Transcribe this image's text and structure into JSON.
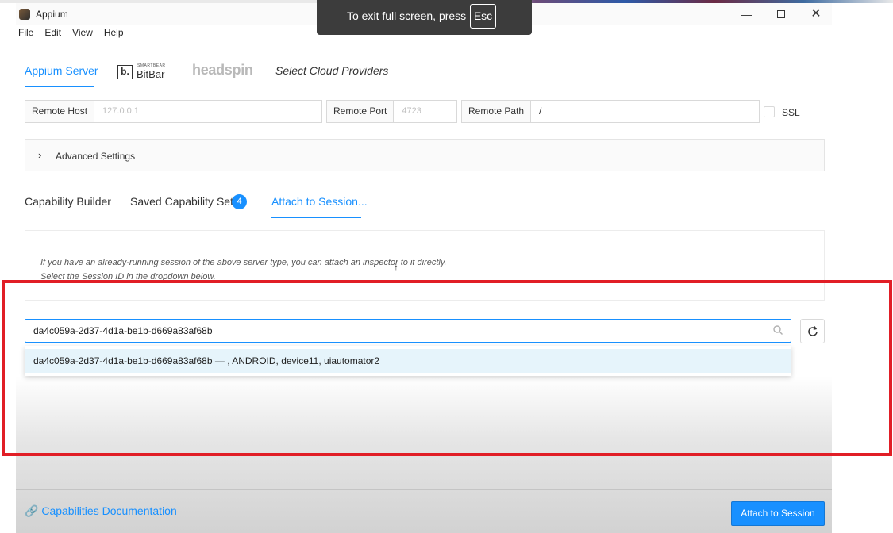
{
  "window": {
    "title": "Appium"
  },
  "menu": [
    "File",
    "Edit",
    "View",
    "Help"
  ],
  "fullscreen_toast": {
    "text": "To exit full screen, press",
    "key": "Esc"
  },
  "providers": {
    "appium_server": "Appium Server",
    "bitbar_small": "SMARTBEAR",
    "bitbar_mark": "b.",
    "bitbar_name": "BitBar",
    "headspin": "headspin",
    "select_cloud": "Select Cloud Providers"
  },
  "server": {
    "remote_host_label": "Remote Host",
    "remote_host_placeholder": "127.0.0.1",
    "remote_port_label": "Remote Port",
    "remote_port_placeholder": "4723",
    "remote_path_label": "Remote Path",
    "remote_path_value": "/",
    "ssl_label": "SSL"
  },
  "advanced_settings": "Advanced Settings",
  "capability_tabs": {
    "builder": "Capability Builder",
    "saved": "Saved Capability Sets",
    "saved_count": "4",
    "attach": "Attach to Session..."
  },
  "attach": {
    "hint_line1": "If you have an already-running session of the above server type, you can attach an inspector to it directly.",
    "hint_line2": "Select the Session ID in the dropdown below.",
    "session_id_value": "da4c059a-2d37-4d1a-be1b-d669a83af68b",
    "dropdown_option": "da4c059a-2d37-4d1a-be1b-d669a83af68b — , ANDROID, device11, uiautomator2"
  },
  "footer": {
    "docs_link": "Capabilities Documentation",
    "attach_button": "Attach to Session"
  },
  "colors": {
    "accent": "#1890ff",
    "highlight": "#e11e26"
  },
  "icons": [
    "minimize-icon",
    "maximize-icon",
    "close-icon",
    "chevron-right-icon",
    "search-icon",
    "refresh-icon",
    "link-icon"
  ]
}
